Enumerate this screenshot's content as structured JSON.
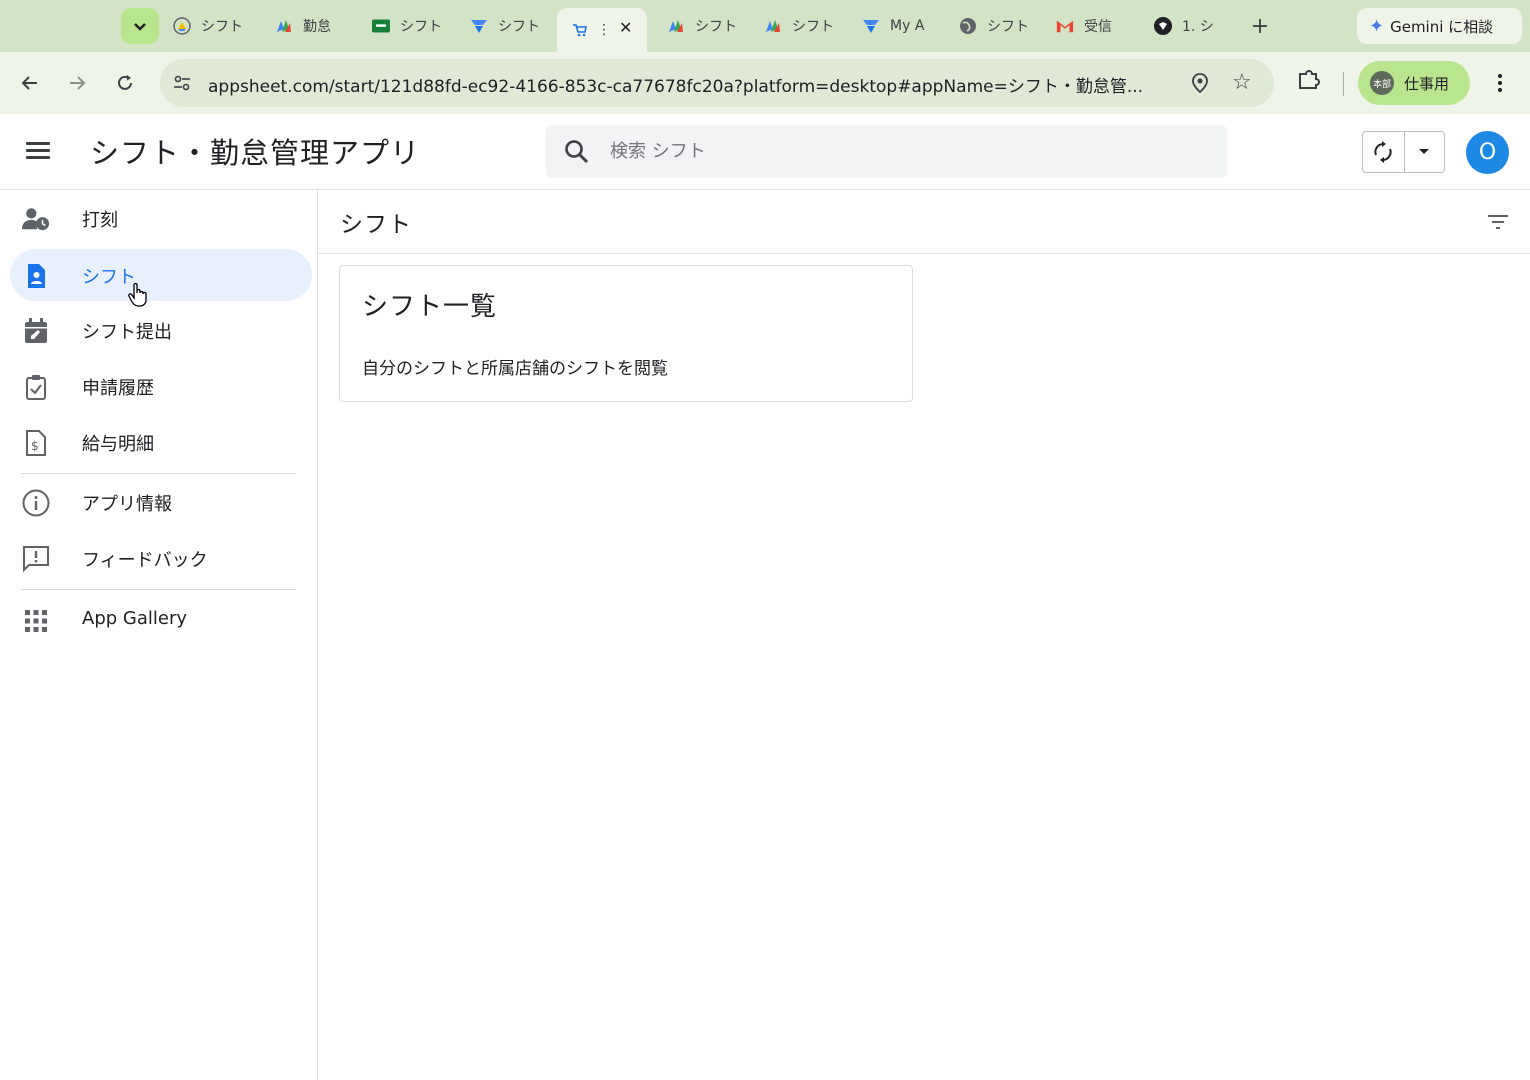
{
  "browser": {
    "tabs": [
      {
        "label": "シフト",
        "icon": "drive-icon"
      },
      {
        "label": "勤怠",
        "icon": "appsheet-icon"
      },
      {
        "label": "シフト",
        "icon": "sheets-icon"
      },
      {
        "label": "シフト",
        "icon": "forms-icon"
      },
      {
        "label": "",
        "icon": "cart-icon",
        "active": true
      },
      {
        "label": "シフト",
        "icon": "appsheet-icon"
      },
      {
        "label": "シフト",
        "icon": "appsheet-icon"
      },
      {
        "label": "My A",
        "icon": "forms-icon"
      },
      {
        "label": "シフト",
        "icon": "globe-icon"
      },
      {
        "label": "受信",
        "icon": "gmail-icon"
      },
      {
        "label": "1. シ",
        "icon": "notion-icon"
      }
    ],
    "gemini_label": "Gemini に相談",
    "url": "appsheet.com/start/121d88fd-ec92-4166-853c-ca77678fc20a?platform=desktop#appName=シフト・勤怠管...",
    "profile_badge": "本部",
    "profile_label": "仕事用"
  },
  "app": {
    "title": "シフト・勤怠管理アプリ",
    "search_placeholder": "検索 シフト",
    "avatar_initial": "O"
  },
  "sidebar": {
    "items": [
      {
        "label": "打刻",
        "icon": "person-clock-icon"
      },
      {
        "label": "シフト",
        "icon": "document-person-icon",
        "active": true
      },
      {
        "label": "シフト提出",
        "icon": "calendar-edit-icon"
      },
      {
        "label": "申請履歴",
        "icon": "clipboard-check-icon"
      },
      {
        "label": "給与明細",
        "icon": "receipt-dollar-icon"
      },
      {
        "label": "アプリ情報",
        "icon": "info-icon"
      },
      {
        "label": "フィードバック",
        "icon": "feedback-icon"
      },
      {
        "label": "App Gallery",
        "icon": "apps-grid-icon"
      }
    ]
  },
  "main": {
    "view_title": "シフト",
    "card": {
      "title": "シフト一覧",
      "description": "自分のシフトと所属店舗のシフトを閲覧"
    }
  },
  "colors": {
    "accent": "#1a73e8",
    "active_bg": "#e8f0fe",
    "avatar": "#1e88e5",
    "chrome_frame": "#d3e3c5",
    "chrome_toolbar": "#eef4e8"
  }
}
